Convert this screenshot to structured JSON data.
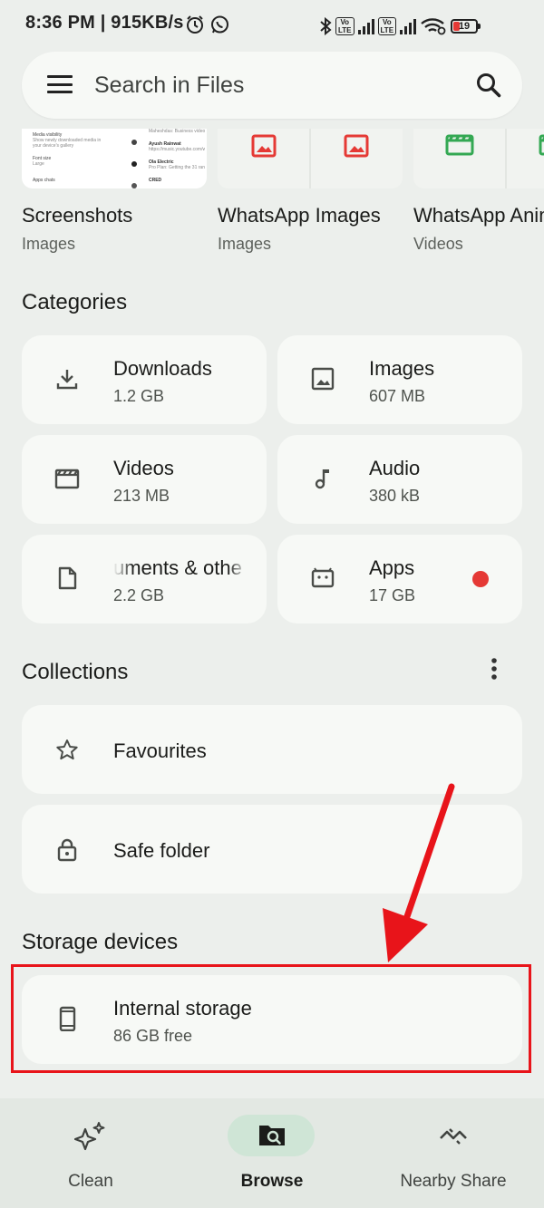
{
  "status_bar": {
    "time_speed": "8:36 PM | 915KB/s",
    "battery": "19"
  },
  "search": {
    "placeholder": "Search in Files"
  },
  "recent": [
    {
      "title": "Screenshots",
      "subtitle": "Images"
    },
    {
      "title": "WhatsApp Images",
      "subtitle": "Images"
    },
    {
      "title": "WhatsApp Animated Gifs",
      "subtitle": "Videos"
    }
  ],
  "screenshot_preview": {
    "left_lines": [
      "Media visibility",
      "Show newly downloaded media in your device's gallery",
      "Font size",
      "Large",
      "Apps chats"
    ],
    "chat_names": [
      "Ayush Rainwat",
      "Ola Electric",
      "CRED"
    ],
    "chat_snippets": [
      "Maheshdas: Business video to 7% data...",
      "https://music.youtube.com/watch?v=...",
      "Pro Plan: Getting the 31 range...",
      ""
    ]
  },
  "categories": {
    "title": "Categories",
    "items": [
      {
        "name": "Downloads",
        "size": "1.2 GB",
        "icon": "download-icon"
      },
      {
        "name": "Images",
        "size": "607 MB",
        "icon": "image-icon"
      },
      {
        "name": "Videos",
        "size": "213 MB",
        "icon": "movie-icon"
      },
      {
        "name": "Audio",
        "size": "380 kB",
        "icon": "music-note-icon"
      },
      {
        "name": "uments & othe",
        "size": "2.2 GB",
        "icon": "document-icon"
      },
      {
        "name": "Apps",
        "size": "17 GB",
        "icon": "android-icon"
      }
    ]
  },
  "collections": {
    "title": "Collections",
    "items": [
      {
        "name": "Favourites",
        "icon": "star-icon"
      },
      {
        "name": "Safe folder",
        "icon": "lock-icon"
      }
    ]
  },
  "storage": {
    "title": "Storage devices",
    "items": [
      {
        "name": "Internal storage",
        "detail": "86 GB free",
        "icon": "phone-icon"
      }
    ]
  },
  "nav": {
    "items": [
      {
        "label": "Clean",
        "icon": "sparkle-icon"
      },
      {
        "label": "Browse",
        "icon": "browse-folder-icon",
        "active": true
      },
      {
        "label": "Nearby Share",
        "icon": "nearby-share-icon"
      }
    ]
  },
  "colors": {
    "background": "#ecefec",
    "card": "#f7f9f6",
    "annotation_red": "#e8141a",
    "badge_red": "#e53935",
    "image_icon_red": "#e53935",
    "video_icon_green": "#34a853"
  }
}
